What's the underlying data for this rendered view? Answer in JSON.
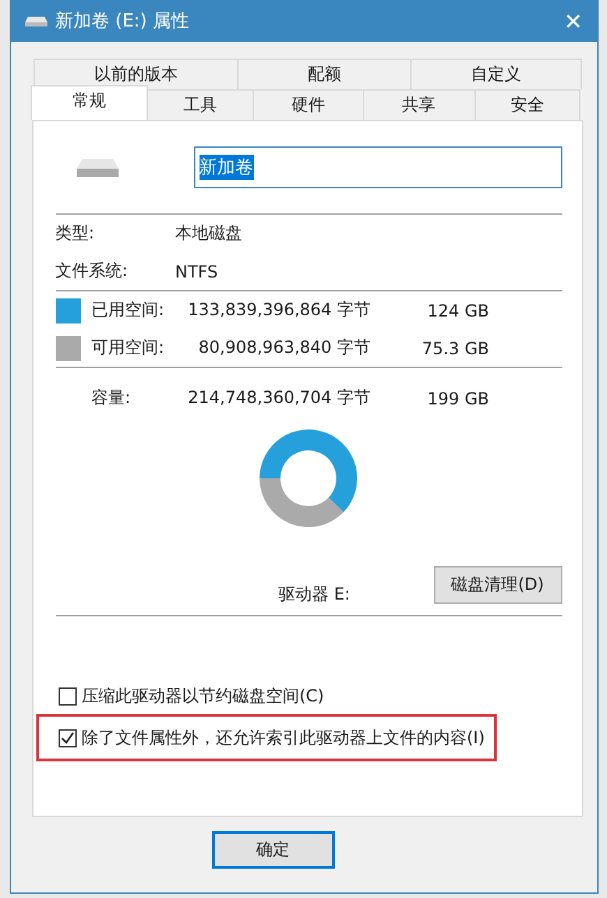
{
  "window": {
    "title": "新加卷 (E:) 属性",
    "close": "✕"
  },
  "tabs_back": [
    {
      "label": "以前的版本",
      "selected": false
    },
    {
      "label": "配额",
      "selected": false
    },
    {
      "label": "自定义",
      "selected": false
    }
  ],
  "tabs_front": [
    {
      "label": "常规",
      "selected": true
    },
    {
      "label": "工具",
      "selected": false
    },
    {
      "label": "硬件",
      "selected": false
    },
    {
      "label": "共享",
      "selected": false
    },
    {
      "label": "安全",
      "selected": false
    }
  ],
  "name_field": {
    "value": "新加卷"
  },
  "info": [
    {
      "label": "类型:",
      "value": "本地磁盘"
    },
    {
      "label": "文件系统:",
      "value": "NTFS"
    }
  ],
  "space": [
    {
      "label": "已用空间:",
      "bytes": "133,839,396,864 字节",
      "size": "124 GB",
      "color": "#26a0da"
    },
    {
      "label": "可用空间:",
      "bytes": "80,908,963,840 字节",
      "size": "75.3 GB",
      "color": "#aaaaaa"
    }
  ],
  "capacity": {
    "label": "容量:",
    "bytes": "214,748,360,704 字节",
    "size": "199 GB"
  },
  "chart_data": {
    "type": "donut",
    "values": [
      62.2,
      37.8
    ]
  },
  "drive_label": "驱动器 E:",
  "cleanup_button": "磁盘清理(D)",
  "options": [
    {
      "label": "压缩此驱动器以节约磁盘空间(C)",
      "checked": false,
      "highlighted": false
    },
    {
      "label": "除了文件属性外，还允许索引此驱动器上文件的内容(I)",
      "checked": true,
      "highlighted": true
    }
  ],
  "buttons": [
    "确定"
  ]
}
